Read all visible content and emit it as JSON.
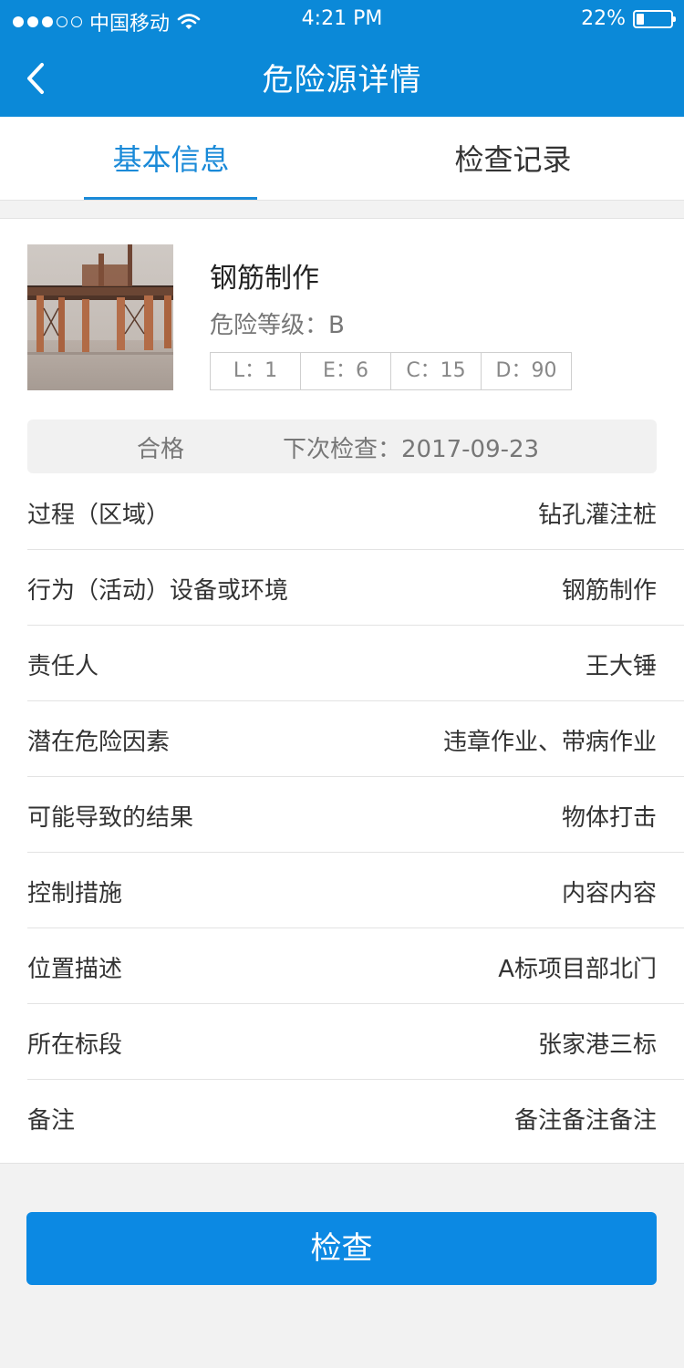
{
  "status_bar": {
    "carrier": "中国移动",
    "time": "4:21 PM",
    "battery_percent": "22%",
    "battery_level": 0.22
  },
  "nav": {
    "title": "危险源详情",
    "back_icon": "chevron-left-icon"
  },
  "tabs": [
    {
      "label": "基本信息",
      "active": true
    },
    {
      "label": "检查记录",
      "active": false
    }
  ],
  "hazard": {
    "name": "钢筋制作",
    "level_text": "危险等级：B",
    "lecd": [
      {
        "text": "L：1"
      },
      {
        "text": "E：6"
      },
      {
        "text": "C：15"
      },
      {
        "text": "D：90"
      }
    ]
  },
  "summary": {
    "status": "合格",
    "next_check": "下次检查：2017-09-23"
  },
  "details": [
    {
      "label": "过程（区域）",
      "value": "钻孔灌注桩"
    },
    {
      "label": "行为（活动）设备或环境",
      "value": "钢筋制作"
    },
    {
      "label": "责任人",
      "value": "王大锤"
    },
    {
      "label": "潜在危险因素",
      "value": "违章作业、带病作业"
    },
    {
      "label": "可能导致的结果",
      "value": "物体打击"
    },
    {
      "label": "控制措施",
      "value": "内容内容"
    },
    {
      "label": "位置描述",
      "value": "A标项目部北门"
    },
    {
      "label": "所在标段",
      "value": "张家港三标"
    },
    {
      "label": "备注",
      "value": "备注备注备注"
    }
  ],
  "actions": {
    "check_button": "检查"
  },
  "colors": {
    "brand": "#0b89d8",
    "tab_active": "#1a8ad8",
    "button": "#0c89e3"
  }
}
